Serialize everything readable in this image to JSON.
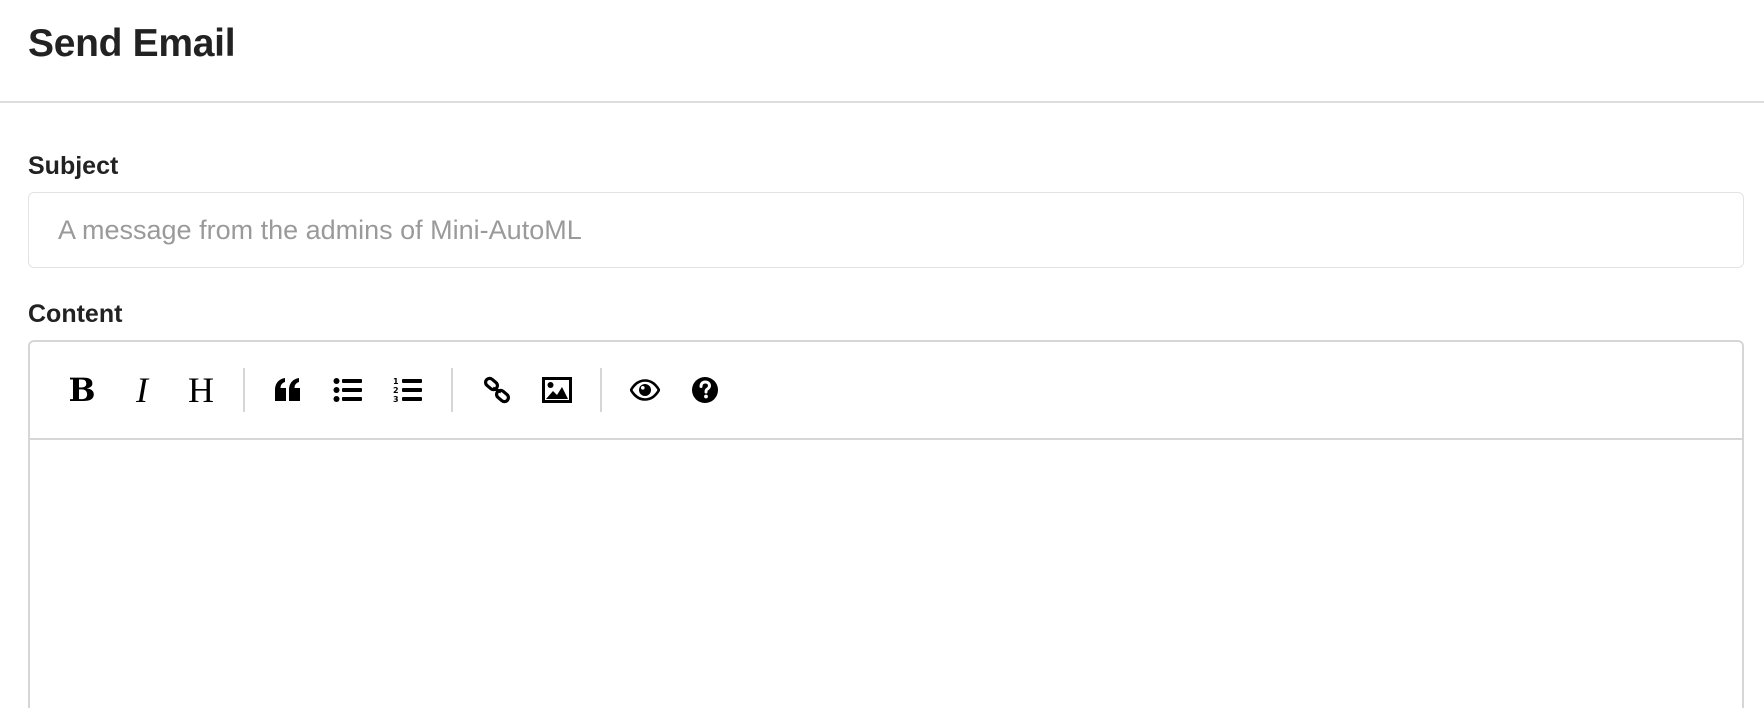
{
  "header": {
    "title": "Send Email"
  },
  "form": {
    "subject_label": "Subject",
    "subject_value": "",
    "subject_placeholder": "A message from the admins of Mini-AutoML",
    "content_label": "Content",
    "content_value": ""
  },
  "toolbar": {
    "bold_label": "B",
    "italic_label": "I",
    "heading_label": "H",
    "icons": [
      "bold-icon",
      "italic-icon",
      "heading-icon",
      "quote-icon",
      "unordered-list-icon",
      "ordered-list-icon",
      "link-icon",
      "image-icon",
      "preview-eye-icon",
      "help-question-icon"
    ]
  }
}
